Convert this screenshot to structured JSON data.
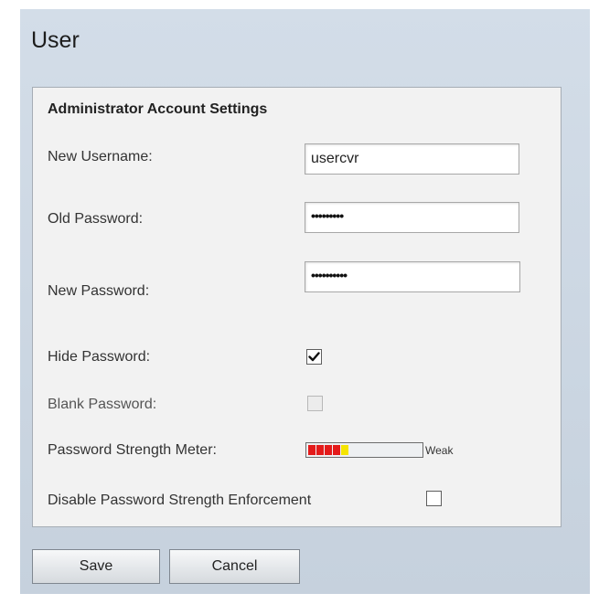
{
  "page": {
    "title": "User"
  },
  "section": {
    "title": "Administrator Account Settings"
  },
  "fields": {
    "new_username": {
      "label": "New Username:",
      "value": "usercvr"
    },
    "old_password": {
      "label": "Old Password:",
      "value": "•••••••••"
    },
    "new_password": {
      "label": "New Password:",
      "value": "••••••••••"
    },
    "hide_password": {
      "label": "Hide Password:",
      "checked": true
    },
    "blank_password": {
      "label": "Blank Password:",
      "checked": false,
      "disabled": true
    },
    "strength_meter": {
      "label": "Password Strength Meter:",
      "status": "Weak",
      "level": 0.35,
      "colors": {
        "red": "#e41b1b",
        "yellow": "#f5e400"
      }
    },
    "disable_enforcement": {
      "label": "Disable Password Strength Enforcement",
      "checked": false
    }
  },
  "actions": {
    "save_label": "Save",
    "cancel_label": "Cancel"
  },
  "icons": {
    "checkmark": "check-icon"
  }
}
